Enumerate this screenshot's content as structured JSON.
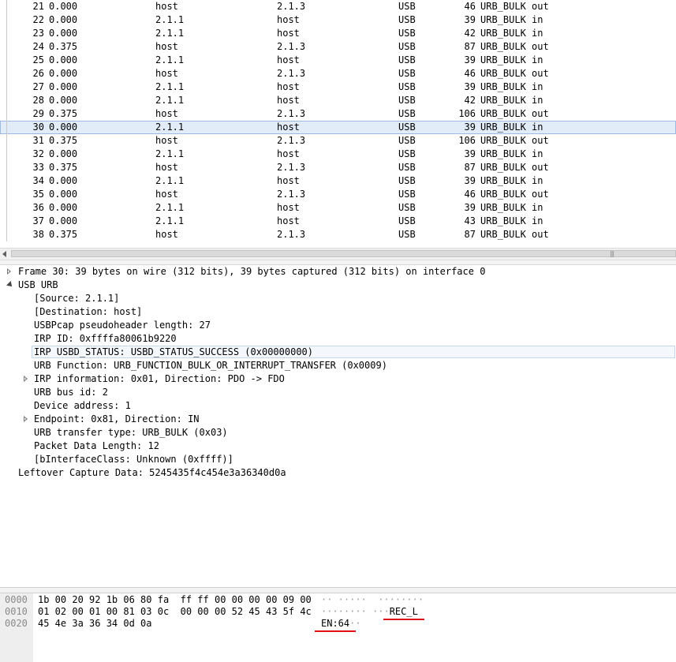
{
  "packets": [
    {
      "no": "21",
      "time": "0.000",
      "source": "host",
      "destination": "2.1.3",
      "protocol": "USB",
      "length": "46",
      "info": "URB_BULK out"
    },
    {
      "no": "22",
      "time": "0.000",
      "source": "2.1.1",
      "destination": "host",
      "protocol": "USB",
      "length": "39",
      "info": "URB_BULK in"
    },
    {
      "no": "23",
      "time": "0.000",
      "source": "2.1.1",
      "destination": "host",
      "protocol": "USB",
      "length": "42",
      "info": "URB_BULK in"
    },
    {
      "no": "24",
      "time": "0.375",
      "source": "host",
      "destination": "2.1.3",
      "protocol": "USB",
      "length": "87",
      "info": "URB_BULK out"
    },
    {
      "no": "25",
      "time": "0.000",
      "source": "2.1.1",
      "destination": "host",
      "protocol": "USB",
      "length": "39",
      "info": "URB_BULK in"
    },
    {
      "no": "26",
      "time": "0.000",
      "source": "host",
      "destination": "2.1.3",
      "protocol": "USB",
      "length": "46",
      "info": "URB_BULK out"
    },
    {
      "no": "27",
      "time": "0.000",
      "source": "2.1.1",
      "destination": "host",
      "protocol": "USB",
      "length": "39",
      "info": "URB_BULK in"
    },
    {
      "no": "28",
      "time": "0.000",
      "source": "2.1.1",
      "destination": "host",
      "protocol": "USB",
      "length": "42",
      "info": "URB_BULK in"
    },
    {
      "no": "29",
      "time": "0.375",
      "source": "host",
      "destination": "2.1.3",
      "protocol": "USB",
      "length": "106",
      "info": "URB_BULK out"
    },
    {
      "no": "30",
      "time": "0.000",
      "source": "2.1.1",
      "destination": "host",
      "protocol": "USB",
      "length": "39",
      "info": "URB_BULK in",
      "selected": true
    },
    {
      "no": "31",
      "time": "0.375",
      "source": "host",
      "destination": "2.1.3",
      "protocol": "USB",
      "length": "106",
      "info": "URB_BULK out"
    },
    {
      "no": "32",
      "time": "0.000",
      "source": "2.1.1",
      "destination": "host",
      "protocol": "USB",
      "length": "39",
      "info": "URB_BULK in"
    },
    {
      "no": "33",
      "time": "0.375",
      "source": "host",
      "destination": "2.1.3",
      "protocol": "USB",
      "length": "87",
      "info": "URB_BULK out"
    },
    {
      "no": "34",
      "time": "0.000",
      "source": "2.1.1",
      "destination": "host",
      "protocol": "USB",
      "length": "39",
      "info": "URB_BULK in"
    },
    {
      "no": "35",
      "time": "0.000",
      "source": "host",
      "destination": "2.1.3",
      "protocol": "USB",
      "length": "46",
      "info": "URB_BULK out"
    },
    {
      "no": "36",
      "time": "0.000",
      "source": "2.1.1",
      "destination": "host",
      "protocol": "USB",
      "length": "39",
      "info": "URB_BULK in"
    },
    {
      "no": "37",
      "time": "0.000",
      "source": "2.1.1",
      "destination": "host",
      "protocol": "USB",
      "length": "43",
      "info": "URB_BULK in"
    },
    {
      "no": "38",
      "time": "0.375",
      "source": "host",
      "destination": "2.1.3",
      "protocol": "USB",
      "length": "87",
      "info": "URB_BULK out"
    }
  ],
  "details": [
    {
      "text": "Frame 30: 39 bytes on wire (312 bits), 39 bytes captured (312 bits) on interface 0",
      "level": 0,
      "toggle": "closed"
    },
    {
      "text": "USB URB",
      "level": 0,
      "toggle": "open"
    },
    {
      "text": "[Source: 2.1.1]",
      "level": 1
    },
    {
      "text": "[Destination: host]",
      "level": 1
    },
    {
      "text": "USBPcap pseudoheader length: 27",
      "level": 1
    },
    {
      "text": "IRP ID: 0xffffa80061b9220",
      "level": 1
    },
    {
      "text": "IRP USBD_STATUS: USBD_STATUS_SUCCESS (0x00000000)",
      "level": 1,
      "highlight": true
    },
    {
      "text": "URB Function: URB_FUNCTION_BULK_OR_INTERRUPT_TRANSFER (0x0009)",
      "level": 1
    },
    {
      "text": "IRP information: 0x01, Direction: PDO -> FDO",
      "level": 1,
      "toggle": "closed"
    },
    {
      "text": "URB bus id: 2",
      "level": 1
    },
    {
      "text": "Device address: 1",
      "level": 1
    },
    {
      "text": "Endpoint: 0x81, Direction: IN",
      "level": 1,
      "toggle": "closed"
    },
    {
      "text": "URB transfer type: URB_BULK (0x03)",
      "level": 1
    },
    {
      "text": "Packet Data Length: 12",
      "level": 1
    },
    {
      "text": "[bInterfaceClass: Unknown (0xffff)]",
      "level": 1
    },
    {
      "text": "Leftover Capture Data: 5245435f4c454e3a36340d0a",
      "level": 0
    }
  ],
  "hex": [
    {
      "offset": "0000",
      "bytes": "1b 00 20 92 1b 06 80 fa  ff ff 00 00 00 00 09 00",
      "ascii_pre": "·· ·····  ········",
      "ascii_mark": "",
      "ascii_post": ""
    },
    {
      "offset": "0010",
      "bytes": "01 02 00 01 00 81 03 0c  00 00 00 52 45 43 5f 4c",
      "ascii_pre": "········ ···",
      "ascii_mark": "REC_L",
      "ascii_post": ""
    },
    {
      "offset": "0020",
      "bytes": "45 4e 3a 36 34 0d 0a",
      "ascii_pre": "",
      "ascii_mark": "EN:64",
      "ascii_post": "··"
    }
  ],
  "colors": {
    "selection": "#e1ecf8",
    "underline": "#e0101a"
  }
}
